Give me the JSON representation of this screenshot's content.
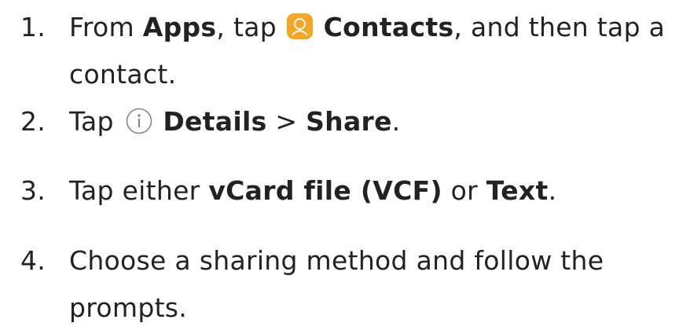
{
  "steps": [
    {
      "number": "1.",
      "prefix": "From ",
      "apps": "Apps",
      "tap": ", tap ",
      "icon": "contacts-app-icon",
      "contacts": "Contacts",
      "suffix": ", and then tap a",
      "line2": "contact."
    },
    {
      "number": "2.",
      "prefix": "Tap ",
      "icon": "info-circle-icon",
      "details": "Details",
      "sep": " > ",
      "share": "Share",
      "suffix": "."
    },
    {
      "number": "3.",
      "prefix": "Tap either ",
      "vcard": "vCard file (VCF)",
      "or": " or ",
      "text": "Text",
      "suffix": "."
    },
    {
      "number": "4.",
      "line1": "Choose a sharing method and follow the",
      "line2": "prompts."
    }
  ],
  "colors": {
    "text": "#222222",
    "app_icon_bg": "#f5a623",
    "icon_outline": "#888888"
  }
}
